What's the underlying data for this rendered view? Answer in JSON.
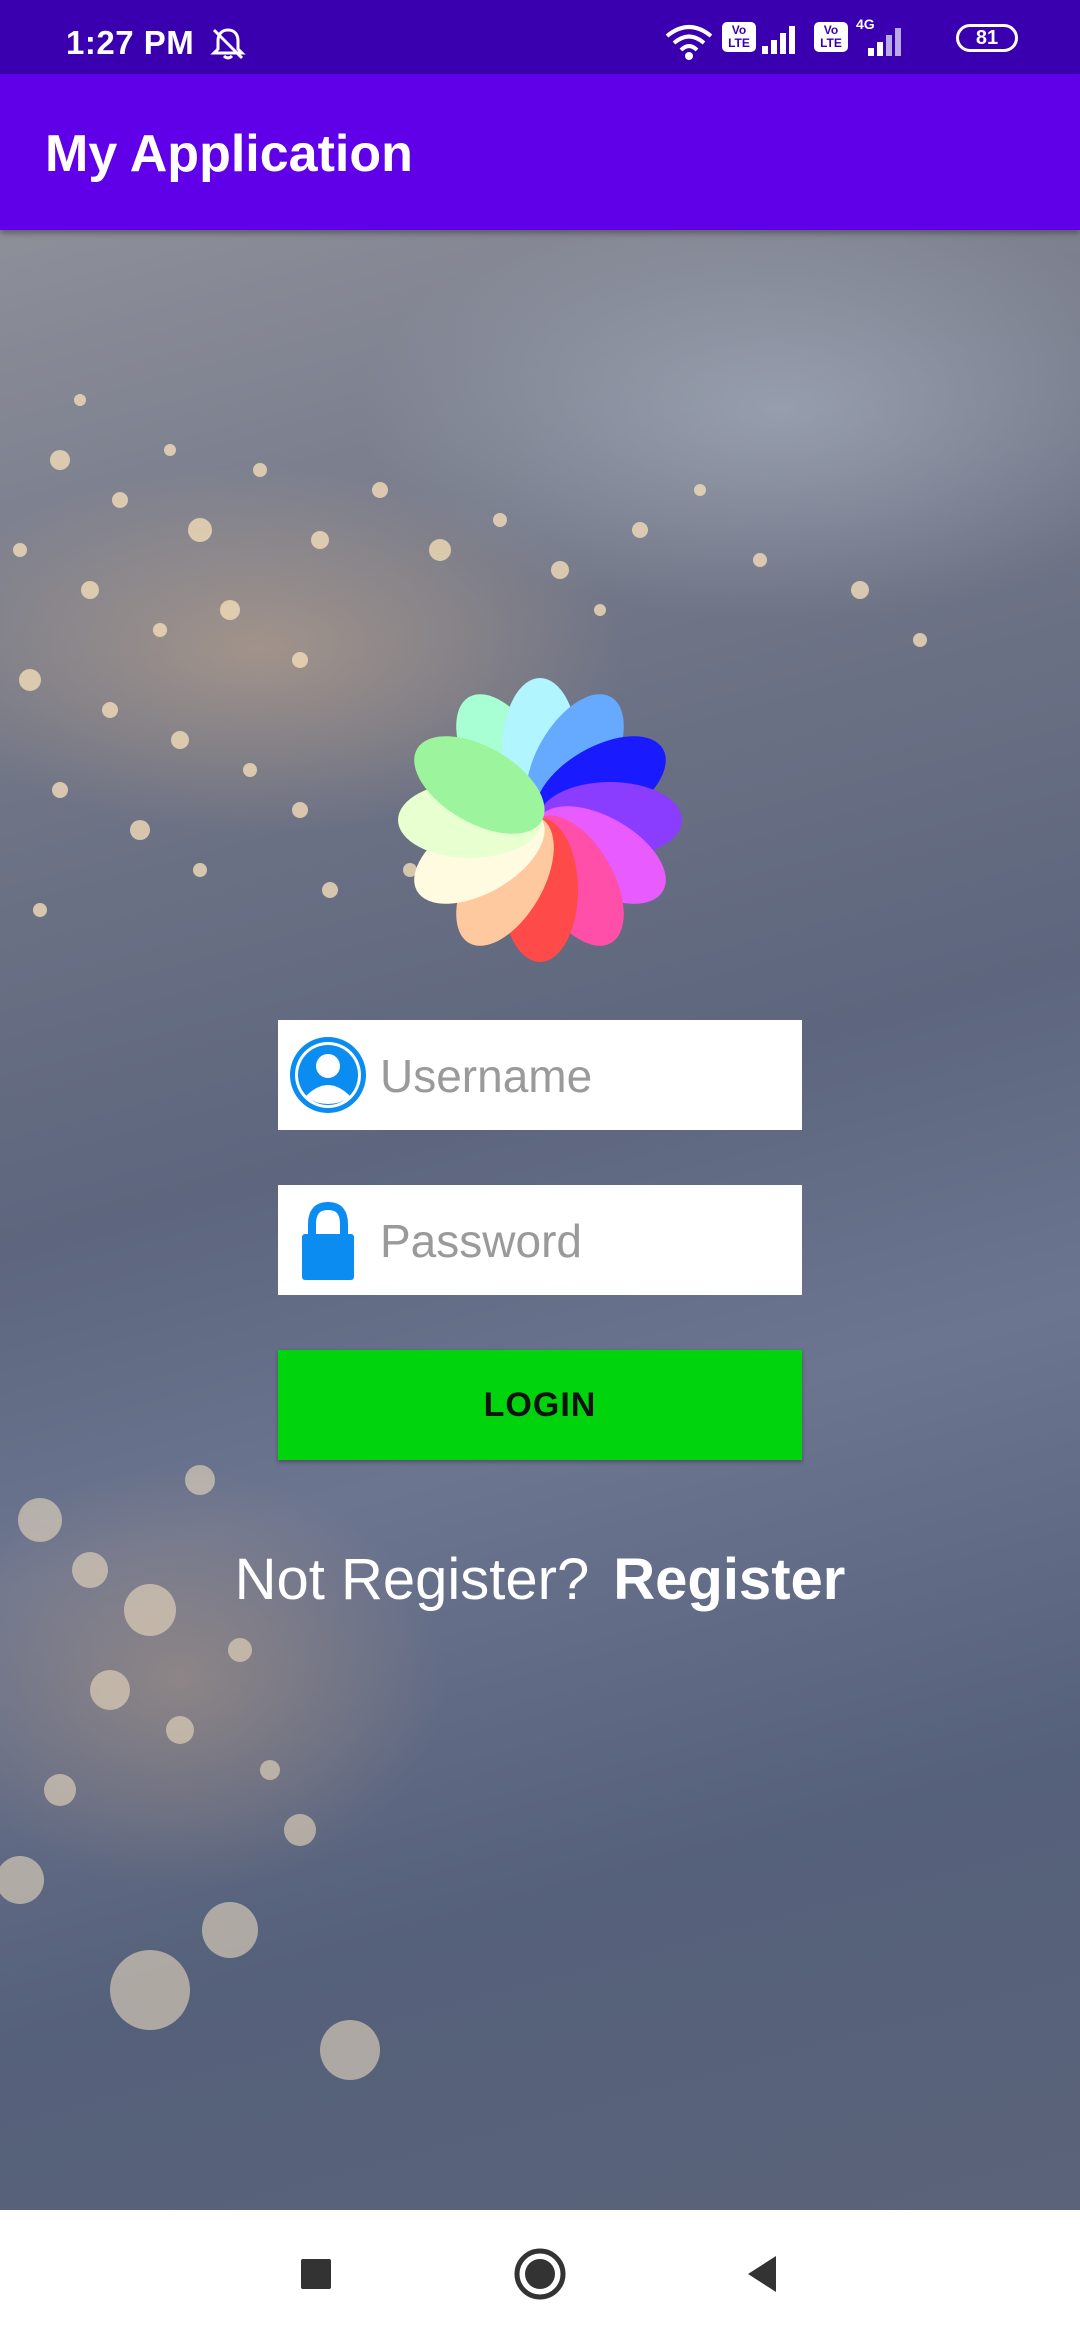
{
  "status_bar": {
    "time": "1:27 PM",
    "battery": "81",
    "network_label": "4G",
    "volte_label": "Vo LTE"
  },
  "app_bar": {
    "title": "My Application"
  },
  "login": {
    "username_placeholder": "Username",
    "password_placeholder": "Password",
    "login_label": "LOGIN",
    "register_prompt": "Not Register?",
    "register_link": "Register"
  },
  "icons": {
    "user": "user-icon",
    "lock": "lock-icon",
    "logo": "flower-logo-icon"
  },
  "colors": {
    "status_bar": "#3a00b0",
    "app_bar": "#5f00e8",
    "login_button": "#00d40d",
    "field_icon": "#0a8cf0"
  }
}
